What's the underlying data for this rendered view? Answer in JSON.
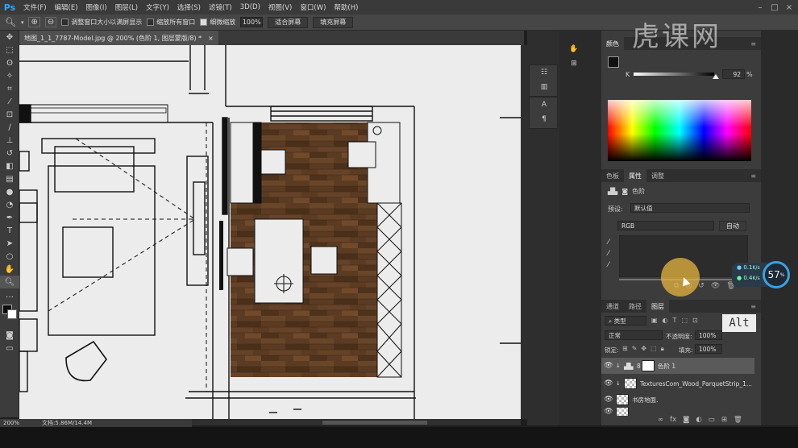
{
  "app": {
    "logo": "Ps"
  },
  "menu": [
    "文件(F)",
    "编辑(E)",
    "图像(I)",
    "图层(L)",
    "文字(Y)",
    "选择(S)",
    "滤镜(T)",
    "3D(D)",
    "视图(V)",
    "窗口(W)",
    "帮助(H)"
  ],
  "options": {
    "resize_window": "调整窗口大小以满屏显示",
    "zoom_all": "缩放所有窗口",
    "scrubby_zoom": "细微缩放",
    "zoom_value": "100%",
    "fit_screen": "适合屏幕",
    "fill_screen": "填充屏幕"
  },
  "document": {
    "tab_title": "地图_1_1_7787-Model.jpg @ 200% (色阶 1, 图层蒙版/8) *",
    "zoom": "200%",
    "doc_size": "文档:5.86M/14.4M"
  },
  "color_panel": {
    "tab": "颜色",
    "channel": "K",
    "value": "92",
    "unit": "%"
  },
  "properties_panel": {
    "tabs": [
      "色板",
      "属性",
      "调整"
    ],
    "active_tab": "属性",
    "adjustment": "色阶",
    "preset_label": "预设:",
    "preset_value": "默认值",
    "channel": "RGB",
    "auto_btn": "自动"
  },
  "layers_panel": {
    "tabs": [
      "通道",
      "路径",
      "图层"
    ],
    "active_tab": "图层",
    "filter": "类型",
    "blend_mode": "正常",
    "opacity_label": "不透明度:",
    "opacity": "100%",
    "lock_label": "锁定:",
    "fill_label": "填充:",
    "fill": "100%",
    "layers": [
      {
        "name": "色阶 1",
        "selected": true
      },
      {
        "name": "TexturesCom_Wood_ParquetStrip_1...",
        "selected": false
      },
      {
        "name": "书房地面.",
        "selected": false
      },
      {
        "name": "",
        "selected": false
      }
    ]
  },
  "overlays": {
    "key_badge": "Alt",
    "perf_percent": "57",
    "perf_unit": "%",
    "net_up": "0.1",
    "net_down": "0.4",
    "net_unit": "K/s"
  },
  "watermark": "虎课网",
  "colors": {
    "ui_dark": "#3c3c3c",
    "canvas": "#ececec",
    "wood": "#5a3b22",
    "accent": "#31a8ff"
  }
}
